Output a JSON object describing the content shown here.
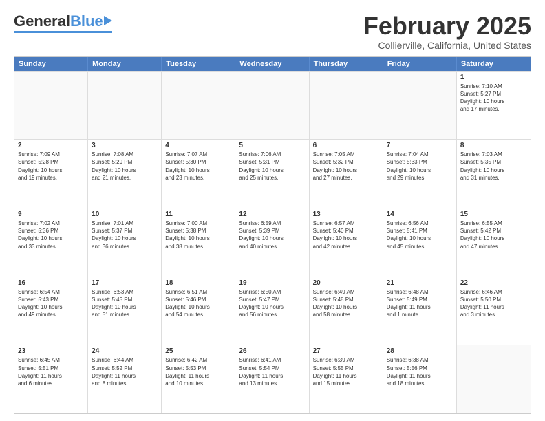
{
  "header": {
    "logo_general": "General",
    "logo_blue": "Blue",
    "title": "February 2025",
    "subtitle": "Collierville, California, United States"
  },
  "calendar": {
    "days": [
      "Sunday",
      "Monday",
      "Tuesday",
      "Wednesday",
      "Thursday",
      "Friday",
      "Saturday"
    ],
    "rows": [
      [
        {
          "day": "",
          "text": "",
          "empty": true
        },
        {
          "day": "",
          "text": "",
          "empty": true
        },
        {
          "day": "",
          "text": "",
          "empty": true
        },
        {
          "day": "",
          "text": "",
          "empty": true
        },
        {
          "day": "",
          "text": "",
          "empty": true
        },
        {
          "day": "",
          "text": "",
          "empty": true
        },
        {
          "day": "1",
          "text": "Sunrise: 7:10 AM\nSunset: 5:27 PM\nDaylight: 10 hours\nand 17 minutes."
        }
      ],
      [
        {
          "day": "2",
          "text": "Sunrise: 7:09 AM\nSunset: 5:28 PM\nDaylight: 10 hours\nand 19 minutes."
        },
        {
          "day": "3",
          "text": "Sunrise: 7:08 AM\nSunset: 5:29 PM\nDaylight: 10 hours\nand 21 minutes."
        },
        {
          "day": "4",
          "text": "Sunrise: 7:07 AM\nSunset: 5:30 PM\nDaylight: 10 hours\nand 23 minutes."
        },
        {
          "day": "5",
          "text": "Sunrise: 7:06 AM\nSunset: 5:31 PM\nDaylight: 10 hours\nand 25 minutes."
        },
        {
          "day": "6",
          "text": "Sunrise: 7:05 AM\nSunset: 5:32 PM\nDaylight: 10 hours\nand 27 minutes."
        },
        {
          "day": "7",
          "text": "Sunrise: 7:04 AM\nSunset: 5:33 PM\nDaylight: 10 hours\nand 29 minutes."
        },
        {
          "day": "8",
          "text": "Sunrise: 7:03 AM\nSunset: 5:35 PM\nDaylight: 10 hours\nand 31 minutes."
        }
      ],
      [
        {
          "day": "9",
          "text": "Sunrise: 7:02 AM\nSunset: 5:36 PM\nDaylight: 10 hours\nand 33 minutes."
        },
        {
          "day": "10",
          "text": "Sunrise: 7:01 AM\nSunset: 5:37 PM\nDaylight: 10 hours\nand 36 minutes."
        },
        {
          "day": "11",
          "text": "Sunrise: 7:00 AM\nSunset: 5:38 PM\nDaylight: 10 hours\nand 38 minutes."
        },
        {
          "day": "12",
          "text": "Sunrise: 6:59 AM\nSunset: 5:39 PM\nDaylight: 10 hours\nand 40 minutes."
        },
        {
          "day": "13",
          "text": "Sunrise: 6:57 AM\nSunset: 5:40 PM\nDaylight: 10 hours\nand 42 minutes."
        },
        {
          "day": "14",
          "text": "Sunrise: 6:56 AM\nSunset: 5:41 PM\nDaylight: 10 hours\nand 45 minutes."
        },
        {
          "day": "15",
          "text": "Sunrise: 6:55 AM\nSunset: 5:42 PM\nDaylight: 10 hours\nand 47 minutes."
        }
      ],
      [
        {
          "day": "16",
          "text": "Sunrise: 6:54 AM\nSunset: 5:43 PM\nDaylight: 10 hours\nand 49 minutes."
        },
        {
          "day": "17",
          "text": "Sunrise: 6:53 AM\nSunset: 5:45 PM\nDaylight: 10 hours\nand 51 minutes."
        },
        {
          "day": "18",
          "text": "Sunrise: 6:51 AM\nSunset: 5:46 PM\nDaylight: 10 hours\nand 54 minutes."
        },
        {
          "day": "19",
          "text": "Sunrise: 6:50 AM\nSunset: 5:47 PM\nDaylight: 10 hours\nand 56 minutes."
        },
        {
          "day": "20",
          "text": "Sunrise: 6:49 AM\nSunset: 5:48 PM\nDaylight: 10 hours\nand 58 minutes."
        },
        {
          "day": "21",
          "text": "Sunrise: 6:48 AM\nSunset: 5:49 PM\nDaylight: 11 hours\nand 1 minute."
        },
        {
          "day": "22",
          "text": "Sunrise: 6:46 AM\nSunset: 5:50 PM\nDaylight: 11 hours\nand 3 minutes."
        }
      ],
      [
        {
          "day": "23",
          "text": "Sunrise: 6:45 AM\nSunset: 5:51 PM\nDaylight: 11 hours\nand 6 minutes."
        },
        {
          "day": "24",
          "text": "Sunrise: 6:44 AM\nSunset: 5:52 PM\nDaylight: 11 hours\nand 8 minutes."
        },
        {
          "day": "25",
          "text": "Sunrise: 6:42 AM\nSunset: 5:53 PM\nDaylight: 11 hours\nand 10 minutes."
        },
        {
          "day": "26",
          "text": "Sunrise: 6:41 AM\nSunset: 5:54 PM\nDaylight: 11 hours\nand 13 minutes."
        },
        {
          "day": "27",
          "text": "Sunrise: 6:39 AM\nSunset: 5:55 PM\nDaylight: 11 hours\nand 15 minutes."
        },
        {
          "day": "28",
          "text": "Sunrise: 6:38 AM\nSunset: 5:56 PM\nDaylight: 11 hours\nand 18 minutes."
        },
        {
          "day": "",
          "text": "",
          "empty": true
        }
      ]
    ]
  }
}
